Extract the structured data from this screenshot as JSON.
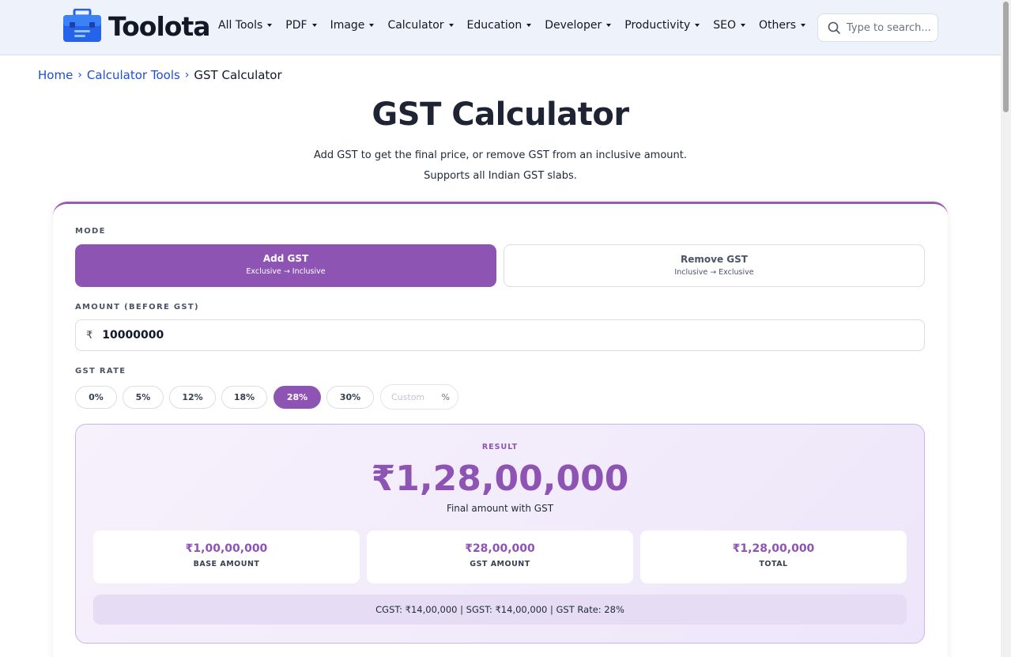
{
  "header": {
    "logo_text": "Toolota",
    "nav": [
      "All Tools",
      "PDF",
      "Image",
      "Calculator",
      "Education",
      "Developer",
      "Productivity",
      "SEO",
      "Others"
    ],
    "search_placeholder": "Type to search..."
  },
  "breadcrumb": {
    "home": "Home",
    "category": "Calculator Tools",
    "current": "GST Calculator"
  },
  "page": {
    "title": "GST Calculator",
    "subtitle_line1": "Add GST to get the final price, or remove GST from an inclusive amount.",
    "subtitle_line2": "Supports all Indian GST slabs."
  },
  "mode": {
    "label": "MODE",
    "add": {
      "title": "Add GST",
      "sub": "Exclusive → Inclusive"
    },
    "remove": {
      "title": "Remove GST",
      "sub": "Inclusive → Exclusive"
    },
    "selected": "add"
  },
  "amount": {
    "label": "AMOUNT (BEFORE GST)",
    "currency_symbol": "₹",
    "value": "10000000"
  },
  "rate": {
    "label": "GST RATE",
    "options": [
      "0%",
      "5%",
      "12%",
      "18%",
      "28%",
      "30%"
    ],
    "selected": "28%",
    "custom_placeholder": "Custom",
    "custom_suffix": "%"
  },
  "result": {
    "label": "RESULT",
    "amount": "₹1,28,00,000",
    "caption": "Final amount with GST",
    "base_value": "₹1,00,00,000",
    "base_label": "BASE AMOUNT",
    "gst_value": "₹28,00,000",
    "gst_label": "GST AMOUNT",
    "total_value": "₹1,28,00,000",
    "total_label": "TOTAL",
    "breakdown": "CGST: ₹14,00,000  |  SGST: ₹14,00,000  |  GST Rate: 28%"
  },
  "colors": {
    "accent": "#8e54b4",
    "link": "#1d4ed8",
    "logo_blue": "#2563eb"
  }
}
